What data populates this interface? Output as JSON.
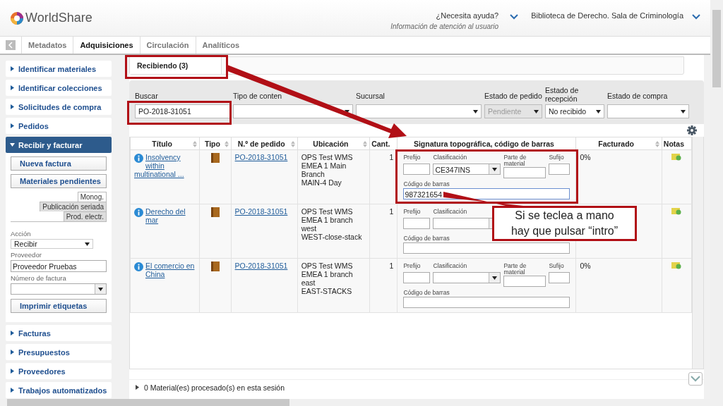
{
  "header": {
    "logo": "WorldShare",
    "help": {
      "label": "¿Necesita ayuda?",
      "subtitle": "Información de atención al usuario"
    },
    "library": "Biblioteca de Derecho. Sala de Criminología"
  },
  "nav_tabs": [
    {
      "label": "Metadatos",
      "selected": false
    },
    {
      "label": "Adquisiciones",
      "selected": true
    },
    {
      "label": "Circulación",
      "selected": false
    },
    {
      "label": "Analíticos",
      "selected": false
    }
  ],
  "sidebar": {
    "items": [
      {
        "label": "Identificar materiales",
        "expanded": false
      },
      {
        "label": "Identificar colecciones",
        "expanded": false
      },
      {
        "label": "Solicitudes de compra",
        "expanded": false
      },
      {
        "label": "Pedidos",
        "expanded": false
      },
      {
        "label": "Recibir y facturar",
        "expanded": true
      },
      {
        "label": "Facturas",
        "expanded": false
      },
      {
        "label": "Presupuestos",
        "expanded": false
      },
      {
        "label": "Proveedores",
        "expanded": false
      },
      {
        "label": "Trabajos automatizados",
        "expanded": false
      }
    ],
    "panel": {
      "buttons": [
        "Nueva factura",
        "Materiales pendientes"
      ],
      "tabs": [
        {
          "label": "Monog.",
          "selected": true
        },
        {
          "label": "Publicación seriada",
          "selected": false
        },
        {
          "label": "Prod. electr.",
          "selected": false
        }
      ],
      "fields": [
        {
          "label": "Acción",
          "kind": "select",
          "value": "Recibir"
        },
        {
          "label": "Proveedor",
          "kind": "text",
          "value": "Proveedor Pruebas"
        },
        {
          "label": "Número de factura",
          "kind": "combo"
        }
      ],
      "print_button": "Imprimir etiquetas"
    }
  },
  "content": {
    "tab": {
      "label": "Recibiendo (3)",
      "selected": true
    },
    "filters": [
      {
        "label": "Buscar",
        "kind": "text",
        "value": "PO-2018-31051",
        "disabled": false
      },
      {
        "label": "Tipo de conten",
        "kind": "select",
        "disabled": false
      },
      {
        "label": "Sucursal",
        "kind": "select",
        "disabled": false
      },
      {
        "label": "Estado de pedido",
        "kind": "select",
        "value": "Pendiente",
        "disabled": true
      },
      {
        "label": "Estado de recepción",
        "kind": "select",
        "value": "No recibido",
        "disabled": false
      },
      {
        "label": "Estado de compra",
        "kind": "select",
        "disabled": false
      }
    ],
    "table": {
      "columns": [
        {
          "label": "Título",
          "sortable": true
        },
        {
          "label": "Tipo",
          "sortable": true
        },
        {
          "label": "N.º de pedido",
          "sortable": true
        },
        {
          "label": "Ubicación",
          "sortable": true
        },
        {
          "label": "Cant.",
          "sortable": false
        },
        {
          "label": "Signatura topográfica, código de barras",
          "sortable": false
        },
        {
          "label": "Facturado",
          "sortable": true
        },
        {
          "label": "Notas",
          "sortable": false
        }
      ],
      "rows": [
        {
          "title": "Insolvency within multinational ...",
          "order": "PO-2018-31051",
          "location": [
            "OPS Test WMS EMEA 1 Main Branch",
            "MAIN-4 Day"
          ],
          "quantity": "1",
          "call_number": [
            {
              "kind": "prefix",
              "label": "Prefijo"
            },
            {
              "kind": "classification",
              "label": "Clasificación",
              "value": "CE347INS"
            },
            {
              "kind": "part",
              "label": "Parte de material"
            },
            {
              "kind": "suffix",
              "label": "Sufijo"
            },
            {
              "kind": "barcode",
              "label": "Código de barras",
              "value": "987321654"
            }
          ],
          "invoiced": "0%"
        },
        {
          "title": "Derecho del mar",
          "order": "PO-2018-31051",
          "location": [
            "OPS Test WMS EMEA 1 branch west",
            "WEST-close-stack"
          ],
          "quantity": "1",
          "call_number": [
            {
              "kind": "prefix",
              "label": "Prefijo"
            },
            {
              "kind": "classification",
              "label": "Clasificación"
            },
            {
              "kind": "barcode",
              "label": "Código de barras"
            }
          ]
        },
        {
          "title": "El comercio en China",
          "order": "PO-2018-31051",
          "location": [
            "OPS Test WMS EMEA 1 branch east",
            "EAST-STACKS"
          ],
          "quantity": "1",
          "call_number": [
            {
              "kind": "prefix",
              "label": "Prefijo"
            },
            {
              "kind": "classification",
              "label": "Clasificación"
            },
            {
              "kind": "part",
              "label": "Parte de material"
            },
            {
              "kind": "suffix",
              "label": "Sufijo"
            },
            {
              "kind": "barcode",
              "label": "Código de barras"
            }
          ],
          "invoiced": "0%"
        }
      ]
    },
    "footer": "0 Material(es) procesado(s) en esta sesión"
  },
  "annotation": {
    "callout": [
      "Si se teclea a mano",
      "hay que pulsar “intro”"
    ]
  }
}
